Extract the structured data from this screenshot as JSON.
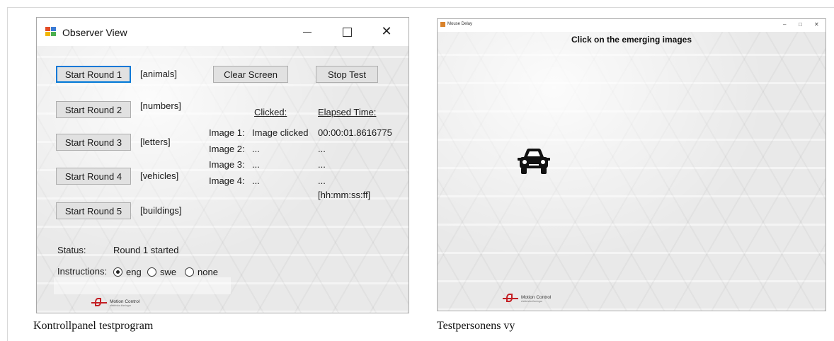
{
  "left_window": {
    "title": "Observer View",
    "buttons": {
      "round1": "Start Round 1",
      "round2": "Start Round 2",
      "round3": "Start Round 3",
      "round4": "Start Round 4",
      "round5": "Start Round 5",
      "clear": "Clear Screen",
      "stop": "Stop Test"
    },
    "categories": [
      "[animals]",
      "[numbers]",
      "[letters]",
      "[vehicles]",
      "[buildings]"
    ],
    "results": {
      "clicked_header": "Clicked:",
      "elapsed_header": "Elapsed Time:",
      "rows": [
        {
          "image": "Image 1:",
          "clicked": "Image clicked",
          "elapsed": "00:00:01.8616775"
        },
        {
          "image": "Image 2:",
          "clicked": "...",
          "elapsed": "..."
        },
        {
          "image": "Image 3:",
          "clicked": "...",
          "elapsed": "..."
        },
        {
          "image": "Image 4:",
          "clicked": "...",
          "elapsed": "..."
        }
      ],
      "time_format": "[hh:mm:ss:ff]"
    },
    "status_label": "Status:",
    "status_value": "Round 1 started",
    "instructions_label": "Instructions:",
    "instruction_options": [
      {
        "label": "eng",
        "selected": true
      },
      {
        "label": "swe",
        "selected": false
      },
      {
        "label": "none",
        "selected": false
      }
    ],
    "logo": {
      "name": "Motion Control",
      "tagline": "elektriska lösningar"
    }
  },
  "right_window": {
    "title": "Mouse Delay",
    "headline": "Click on the emerging images",
    "stimulus_icon": "car-icon",
    "logo": {
      "name": "Motion Control",
      "tagline": "elektriska lösningar"
    }
  },
  "captions": {
    "left": "Kontrollpanel testprogram",
    "right": "Testpersonens vy"
  },
  "colors": {
    "focus_border": "#0078d7",
    "logo_red": "#c31f24",
    "button_face": "#e1e1e1"
  }
}
